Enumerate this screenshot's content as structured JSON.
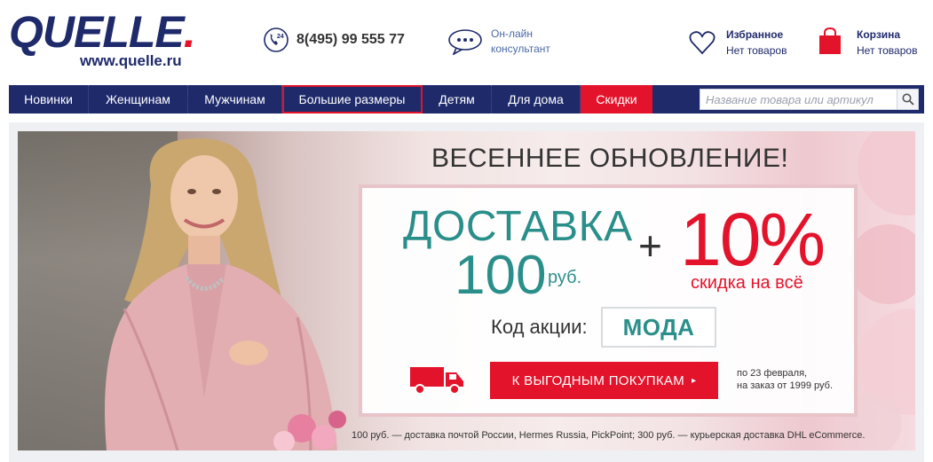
{
  "header": {
    "logo_word": "QUELLE",
    "logo_dot": ".",
    "logo_url": "www.quelle.ru",
    "phone": "8(495) 99 555 77",
    "phone_badge": "24",
    "chat_line1": "Он-лайн",
    "chat_line2": "консультант",
    "favorites_title": "Избранное",
    "favorites_sub": "Нет товаров",
    "cart_title": "Корзина",
    "cart_sub": "Нет товаров"
  },
  "nav": {
    "items": [
      {
        "label": "Новинки"
      },
      {
        "label": "Женщинам"
      },
      {
        "label": "Мужчинам"
      },
      {
        "label": "Большие размеры"
      },
      {
        "label": "Детям"
      },
      {
        "label": "Для дома"
      },
      {
        "label": "Скидки"
      }
    ],
    "search_placeholder": "Название товара или артикул"
  },
  "banner": {
    "headline": "ВЕСЕННЕЕ ОБНОВЛЕНИЕ!",
    "delivery_title": "ДОСТАВКА",
    "delivery_amount": "100",
    "delivery_currency": "руб.",
    "plus": "+",
    "discount": "10%",
    "discount_sub": "скидка на всё",
    "code_label": "Код акции:",
    "code_value": "МОДА",
    "cta_label": "К ВЫГОДНЫМ ПОКУПКАМ",
    "cta_arrow": "▸",
    "note_line1": "по 23 февраля,",
    "note_line2": "на заказ от 1999 руб.",
    "footnote": "100 руб. — доставка почтой России, Hermes Russia, PickPoint;   300 руб. — курьерская доставка DHL eCommerce."
  },
  "colors": {
    "brand_navy": "#1f2a6b",
    "brand_red": "#e3132b",
    "teal": "#2a8f8a"
  }
}
